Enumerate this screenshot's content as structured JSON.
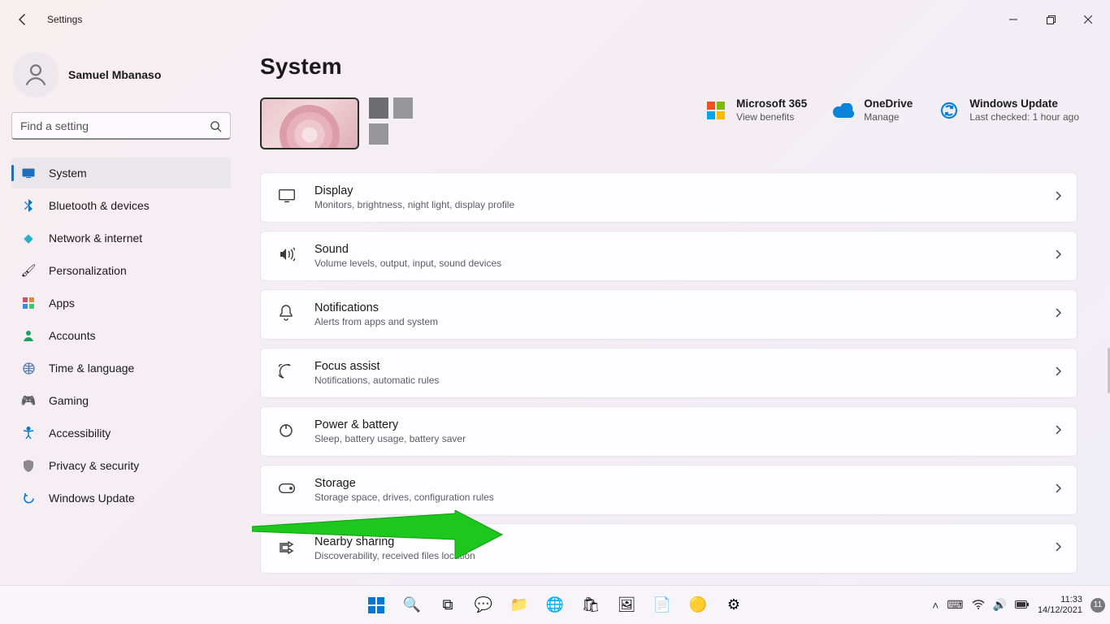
{
  "window": {
    "title": "Settings"
  },
  "user": {
    "name": "Samuel Mbanaso"
  },
  "search": {
    "placeholder": "Find a setting"
  },
  "nav": {
    "items": [
      {
        "icon": "system-icon",
        "label": "System",
        "active": true,
        "color": "#0078d4"
      },
      {
        "icon": "bluetooth-icon",
        "label": "Bluetooth & devices",
        "color": "#0078d4"
      },
      {
        "icon": "network-icon",
        "label": "Network & internet",
        "color": "#00a3c4"
      },
      {
        "icon": "personalization-icon",
        "label": "Personalization",
        "color": "#c0705c"
      },
      {
        "icon": "apps-icon",
        "label": "Apps",
        "color": "#c94f6d"
      },
      {
        "icon": "accounts-icon",
        "label": "Accounts",
        "color": "#1aa260"
      },
      {
        "icon": "time-language-icon",
        "label": "Time & language",
        "color": "#4d7ab8"
      },
      {
        "icon": "gaming-icon",
        "label": "Gaming",
        "color": "#7a7a7a"
      },
      {
        "icon": "accessibility-icon",
        "label": "Accessibility",
        "color": "#0078d4"
      },
      {
        "icon": "privacy-icon",
        "label": "Privacy & security",
        "color": "#8a8a8d"
      },
      {
        "icon": "windows-update-icon",
        "label": "Windows Update",
        "color": "#0078d4"
      }
    ]
  },
  "page": {
    "title": "System"
  },
  "quick_links": [
    {
      "icon": "ms365-icon",
      "title": "Microsoft 365",
      "sub": "View benefits"
    },
    {
      "icon": "onedrive-icon",
      "title": "OneDrive",
      "sub": "Manage"
    },
    {
      "icon": "windows-update-icon",
      "title": "Windows Update",
      "sub": "Last checked: 1 hour ago"
    }
  ],
  "cards": [
    {
      "icon": "display-icon",
      "title": "Display",
      "sub": "Monitors, brightness, night light, display profile"
    },
    {
      "icon": "sound-icon",
      "title": "Sound",
      "sub": "Volume levels, output, input, sound devices"
    },
    {
      "icon": "notifications-icon",
      "title": "Notifications",
      "sub": "Alerts from apps and system"
    },
    {
      "icon": "focus-assist-icon",
      "title": "Focus assist",
      "sub": "Notifications, automatic rules"
    },
    {
      "icon": "power-battery-icon",
      "title": "Power & battery",
      "sub": "Sleep, battery usage, battery saver"
    },
    {
      "icon": "storage-icon",
      "title": "Storage",
      "sub": "Storage space, drives, configuration rules"
    },
    {
      "icon": "nearby-sharing-icon",
      "title": "Nearby sharing",
      "sub": "Discoverability, received files location"
    }
  ],
  "taskbar": {
    "apps": [
      {
        "name": "start",
        "glyph": "win"
      },
      {
        "name": "search",
        "glyph": "🔍"
      },
      {
        "name": "task-view",
        "glyph": "⧉"
      },
      {
        "name": "chat",
        "glyph": "💬"
      },
      {
        "name": "file-explorer",
        "glyph": "📁"
      },
      {
        "name": "edge",
        "glyph": "🌐"
      },
      {
        "name": "store",
        "glyph": "🛍"
      },
      {
        "name": "photos",
        "glyph": "🖼"
      },
      {
        "name": "word",
        "glyph": "📄"
      },
      {
        "name": "chrome",
        "glyph": "🟡"
      },
      {
        "name": "settings",
        "glyph": "⚙"
      }
    ],
    "clock": {
      "time": "11:33",
      "date": "14/12/2021"
    },
    "badge": "11"
  },
  "annotation": {
    "target": "storage-card"
  }
}
